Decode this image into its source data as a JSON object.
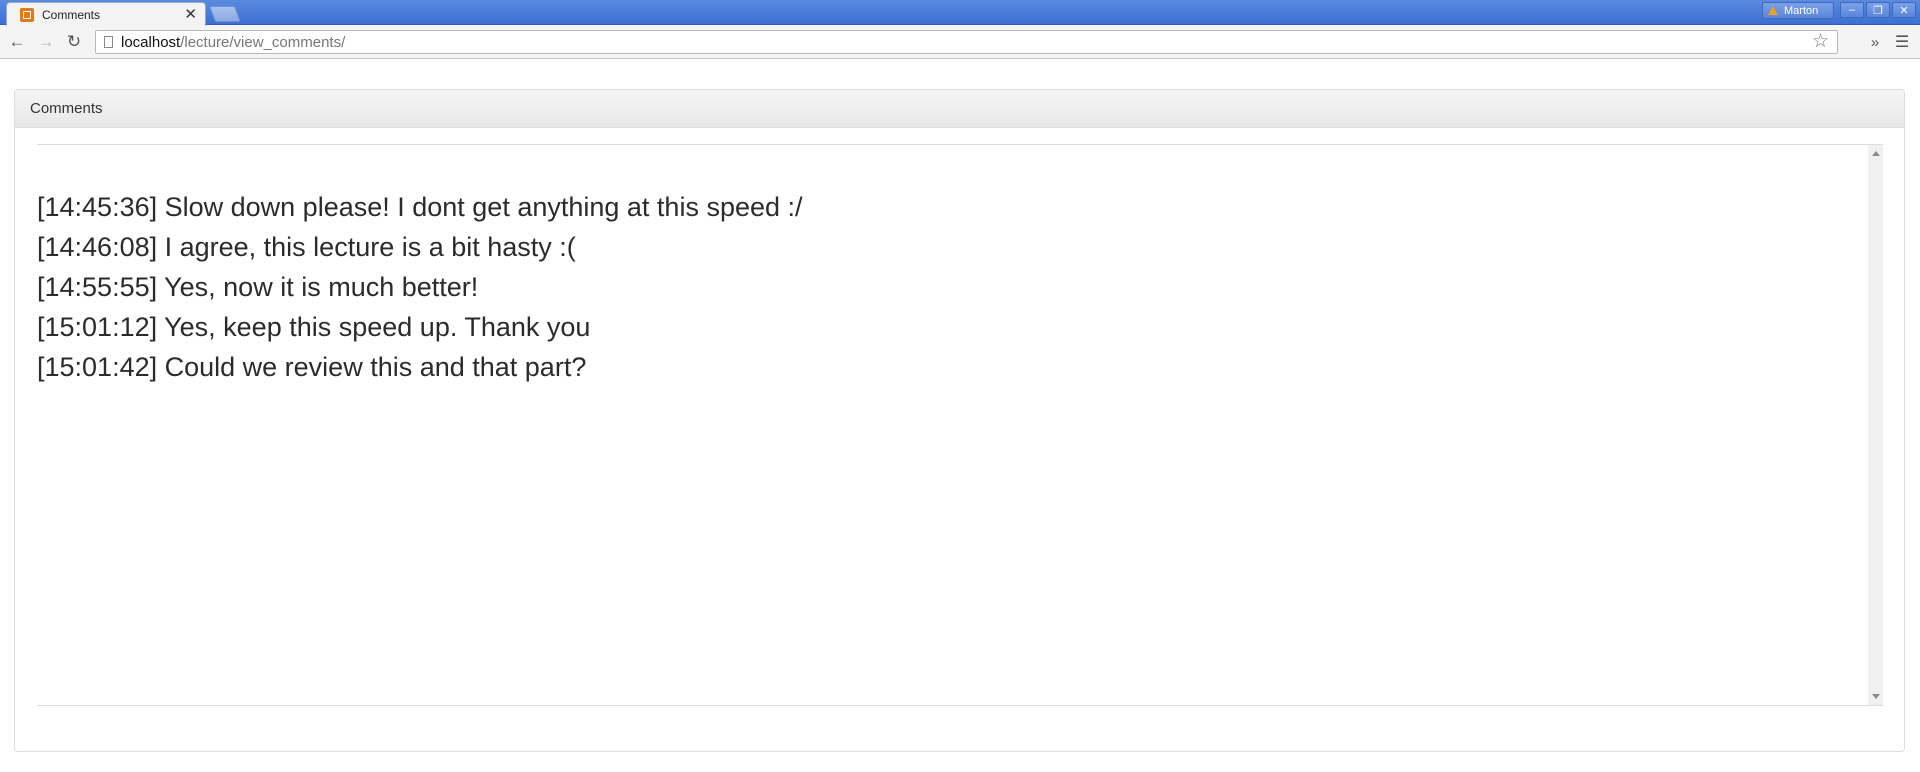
{
  "tab": {
    "title": "Comments",
    "close_glyph": "✕",
    "favicon": "xampp-icon"
  },
  "profile": {
    "name": "Marton",
    "icon": "warning-icon"
  },
  "window_controls": {
    "minimize": "–",
    "restore": "❐",
    "close": "✕"
  },
  "toolbar": {
    "back_glyph": "←",
    "forward_glyph": "→",
    "reload_glyph": "↻",
    "url_host": "localhost",
    "url_path": "/lecture/view_comments/",
    "bookmark_glyph": "☆",
    "extensions_glyph": "»",
    "menu_glyph": "☰"
  },
  "panel": {
    "heading": "Comments",
    "comments": [
      "[14:45:36] Slow down please! I dont get anything at this speed :/",
      "[14:46:08] I agree, this lecture is a bit hasty :(",
      "[14:55:55] Yes, now it is much better!",
      "[15:01:12] Yes, keep this speed up. Thank you",
      "[15:01:42] Could we review this and that part?"
    ]
  },
  "colors": {
    "titlebar": "#3c6fd3",
    "panel_border": "#dddddd",
    "text": "#2b2b2b",
    "favicon": "#e07a1a"
  }
}
